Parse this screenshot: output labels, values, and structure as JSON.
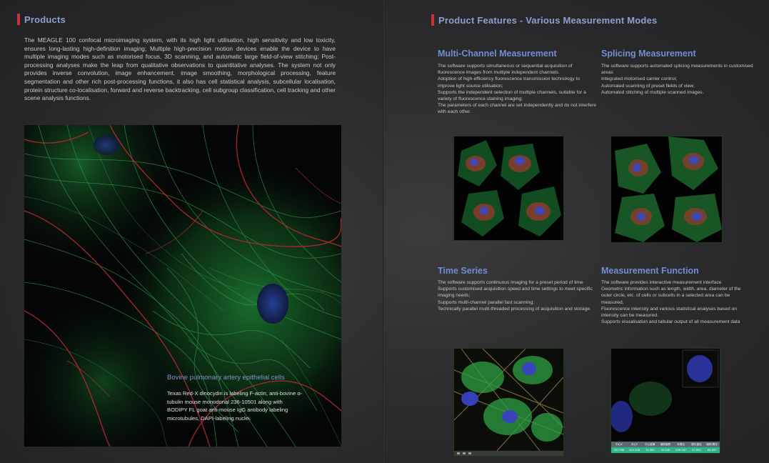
{
  "left": {
    "section_title": "Products",
    "intro": "The MEAGLE 100 confocal microimaging system, with its high light utilisation, high sensitivity and low toxicity, ensures long-lasting high-definition imaging; Multiple high-precision motion devices enable the device to have multiple imaging modes such as motorised focus, 3D scanning, and automatic large field-of-view stitching; Post-processing analyses make the leap from qualitative observations to quantitative analyses. The system not only provides inverse convolution, image enhancement, image smoothing, morphological processing, feature segmentation and other rich post-processing functions, it also has cell statistical analysis, subcellular localisation, protein structure co-localisation, forward and reverse backtracking, cell subgroup classification, cell tracking and other scene analysis functions.",
    "caption_title": "Bovine pulmonary artery epithelial cells",
    "caption_body": "Texas Red-X dinocydin is labeling F-actin, anti-bovine α-tubulin mouse monodonal 236-10501 along with BODIPY FL goat anti-mouse IgG antibody labeling microtubules, DAPI-labeling nuclei."
  },
  "right": {
    "section_title": "Product Features - Various Measurement Modes",
    "features": [
      {
        "title": "Multi-Channel Measurement",
        "desc": "The software supports simultaneous or sequential acquisition of fluorescence images from multiple independent channels.\n  Adoption of high-efficiency fluorescence transmission technology to improve light source utilisation;\n  Supports the independent selection of multiple channels, suitable for a variety of fluorescence staining imaging;\n  The parameters of each channel are set independently and do not interfere with each other."
      },
      {
        "title": "Splicing Measurement",
        "desc": "The software supports automated splicing measurements in customised areas\n  Integrated motorised carrier control;\n  Automated scanning of preset fields of view;\n  Automated stitching of multiple scanned images."
      },
      {
        "title": "Time Series",
        "desc": "The software supports continuous imaging for a preset period of time\n  Supports customised acquisition speed and time settings to meet specific imaging needs;\n  Supports multi-channel parallel fast scanning;\n  Technically parallel multi-threaded processing of acquisition and storage."
      },
      {
        "title": "Measurement Function",
        "desc": "The software provides interactive measurement interface\n  Geometric information such as length, width, area, diameter of the outer circle, etc. of cells or subcells in a selected area can be measured.\n  Fluorescence intensity and various statistical analyses based on intensity can be measured.\n  Supports visualisation and tabular output of all measurement data"
      }
    ],
    "measure_table": {
      "headers": [
        "中心X",
        "中心Y",
        "中心距离",
        "面积面积",
        "外周长",
        "周长直径",
        "面积/周长"
      ],
      "values": [
        "302.998",
        "222.308",
        "74.000",
        "35.440",
        "456.767",
        "47.000",
        "84.997"
      ]
    }
  },
  "colors": {
    "accent_red": "#c8323a",
    "heading_blue": "#6f8fd0",
    "actin_red": "#b4282a",
    "tubulin_green": "#2fa14a",
    "nuclei_blue": "#3440b8",
    "table_green": "#2fb38a"
  }
}
